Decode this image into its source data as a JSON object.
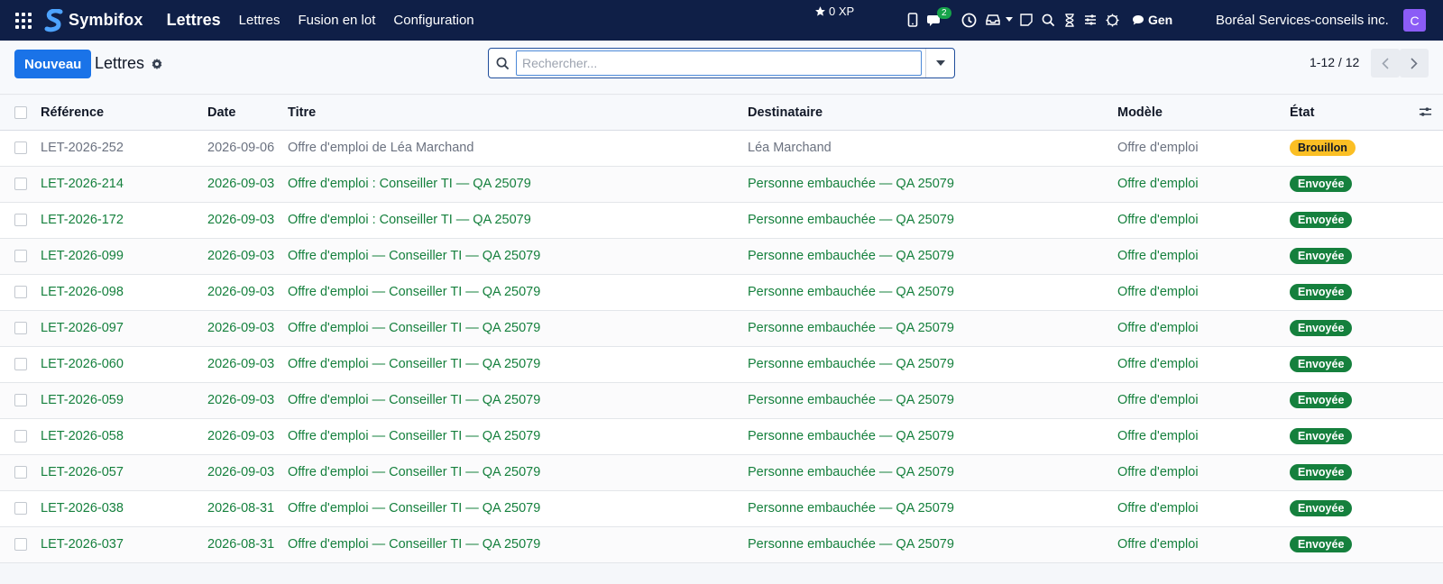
{
  "navbar": {
    "brand": "Symbifox",
    "app_name": "Lettres",
    "menu": [
      "Lettres",
      "Fusion en lot",
      "Configuration"
    ],
    "xp": "0 XP",
    "messages_badge": "2",
    "gen_label": "Gen",
    "company": "Boréal Services-conseils inc.",
    "avatar_initial": "C"
  },
  "control": {
    "new_button": "Nouveau",
    "breadcrumb": "Lettres",
    "search_placeholder": "Rechercher...",
    "pager": "1-12 / 12"
  },
  "table": {
    "headers": {
      "reference": "Référence",
      "date": "Date",
      "title": "Titre",
      "recipient": "Destinataire",
      "model": "Modèle",
      "state": "État"
    },
    "rows": [
      {
        "reference": "LET-2026-252",
        "date": "2026-09-06",
        "title": "Offre d'emploi de Léa Marchand",
        "recipient": "Léa Marchand",
        "model": "Offre d'emploi",
        "state": "Brouillon",
        "kind": "draft"
      },
      {
        "reference": "LET-2026-214",
        "date": "2026-09-03",
        "title": "Offre d'emploi : Conseiller TI — QA 25079",
        "recipient": "Personne embauchée — QA 25079",
        "model": "Offre d'emploi",
        "state": "Envoyée",
        "kind": "sent"
      },
      {
        "reference": "LET-2026-172",
        "date": "2026-09-03",
        "title": "Offre d'emploi : Conseiller TI — QA 25079",
        "recipient": "Personne embauchée — QA 25079",
        "model": "Offre d'emploi",
        "state": "Envoyée",
        "kind": "sent"
      },
      {
        "reference": "LET-2026-099",
        "date": "2026-09-03",
        "title": "Offre d'emploi — Conseiller TI — QA 25079",
        "recipient": "Personne embauchée — QA 25079",
        "model": "Offre d'emploi",
        "state": "Envoyée",
        "kind": "sent"
      },
      {
        "reference": "LET-2026-098",
        "date": "2026-09-03",
        "title": "Offre d'emploi — Conseiller TI — QA 25079",
        "recipient": "Personne embauchée — QA 25079",
        "model": "Offre d'emploi",
        "state": "Envoyée",
        "kind": "sent"
      },
      {
        "reference": "LET-2026-097",
        "date": "2026-09-03",
        "title": "Offre d'emploi — Conseiller TI — QA 25079",
        "recipient": "Personne embauchée — QA 25079",
        "model": "Offre d'emploi",
        "state": "Envoyée",
        "kind": "sent"
      },
      {
        "reference": "LET-2026-060",
        "date": "2026-09-03",
        "title": "Offre d'emploi — Conseiller TI — QA 25079",
        "recipient": "Personne embauchée — QA 25079",
        "model": "Offre d'emploi",
        "state": "Envoyée",
        "kind": "sent"
      },
      {
        "reference": "LET-2026-059",
        "date": "2026-09-03",
        "title": "Offre d'emploi — Conseiller TI — QA 25079",
        "recipient": "Personne embauchée — QA 25079",
        "model": "Offre d'emploi",
        "state": "Envoyée",
        "kind": "sent"
      },
      {
        "reference": "LET-2026-058",
        "date": "2026-09-03",
        "title": "Offre d'emploi — Conseiller TI — QA 25079",
        "recipient": "Personne embauchée — QA 25079",
        "model": "Offre d'emploi",
        "state": "Envoyée",
        "kind": "sent"
      },
      {
        "reference": "LET-2026-057",
        "date": "2026-09-03",
        "title": "Offre d'emploi — Conseiller TI — QA 25079",
        "recipient": "Personne embauchée — QA 25079",
        "model": "Offre d'emploi",
        "state": "Envoyée",
        "kind": "sent"
      },
      {
        "reference": "LET-2026-038",
        "date": "2026-08-31",
        "title": "Offre d'emploi — Conseiller TI — QA 25079",
        "recipient": "Personne embauchée — QA 25079",
        "model": "Offre d'emploi",
        "state": "Envoyée",
        "kind": "sent"
      },
      {
        "reference": "LET-2026-037",
        "date": "2026-08-31",
        "title": "Offre d'emploi — Conseiller TI — QA 25079",
        "recipient": "Personne embauchée — QA 25079",
        "model": "Offre d'emploi",
        "state": "Envoyée",
        "kind": "sent"
      }
    ]
  },
  "colors": {
    "navbar": "#0f1f47",
    "primary": "#1a73e8",
    "sent": "#15803d",
    "draft": "#fbbf24",
    "avatar": "#8b5cf6"
  },
  "icons": [
    "apps-grid-icon",
    "symbifox-logo-icon",
    "star-icon",
    "phone-icon",
    "chat-icon",
    "clock-icon",
    "inbox-icon",
    "caret-down-icon",
    "note-icon",
    "search-icon",
    "hourglass-icon",
    "sliders-icon",
    "bug-icon",
    "comment-icon",
    "gear-icon",
    "chevron-left-icon",
    "chevron-right-icon",
    "column-settings-icon"
  ]
}
